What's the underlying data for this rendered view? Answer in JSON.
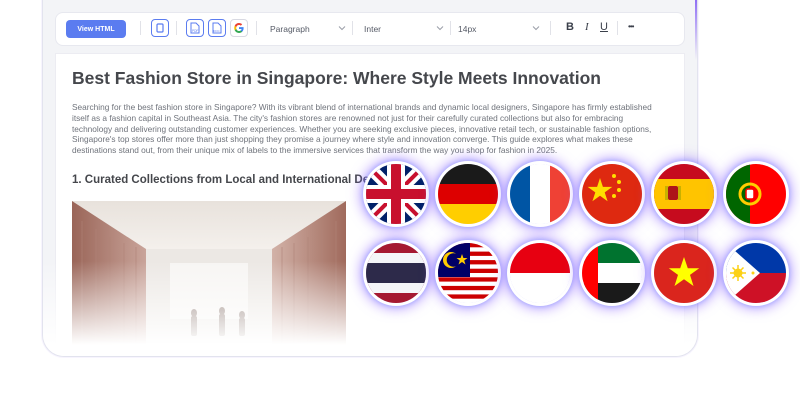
{
  "toolbar": {
    "view_html_label": "View HTML",
    "block_format": "Paragraph",
    "font_family": "Inter",
    "font_size": "14px",
    "bold_label": "B",
    "italic_label": "I",
    "underline_label": "U",
    "more_label": "•••",
    "icons": [
      "copy-icon",
      "pdf-icon",
      "docx-icon",
      "google-docs-icon"
    ]
  },
  "document": {
    "title": "Best Fashion Store in Singapore: Where Style Meets Innovation",
    "intro": "Searching for the best fashion store in Singapore? With its vibrant blend of international brands and dynamic local designers, Singapore has firmly established itself as a fashion capital in Southeast Asia. The city's fashion stores are renowned not just for their carefully curated collections but also for embracing technology and delivering outstanding customer experiences. Whether you are seeking exclusive pieces, innovative retail tech, or sustainable fashion options, Singapore's top stores offer more than just shopping they promise a journey where style and innovation converge. This guide explores what makes these destinations stand out, from their unique mix of labels to the immersive services that transform the way you shop for fashion in 2025.",
    "section_heading": "1. Curated Collections from Local and International Designers"
  },
  "flags": [
    {
      "name": "united-kingdom",
      "row": 1
    },
    {
      "name": "germany",
      "row": 1
    },
    {
      "name": "france",
      "row": 1
    },
    {
      "name": "china",
      "row": 1
    },
    {
      "name": "spain",
      "row": 1
    },
    {
      "name": "portugal",
      "row": 1
    },
    {
      "name": "thailand",
      "row": 2
    },
    {
      "name": "malaysia",
      "row": 2
    },
    {
      "name": "indonesia",
      "row": 2
    },
    {
      "name": "united-arab-emirates",
      "row": 2
    },
    {
      "name": "vietnam",
      "row": 2
    },
    {
      "name": "philippines",
      "row": 2
    }
  ],
  "colors": {
    "accent": "#5b7cf0",
    "glow": "#8c5fff",
    "title_text": "#45474c",
    "body_text": "#6f737b"
  }
}
